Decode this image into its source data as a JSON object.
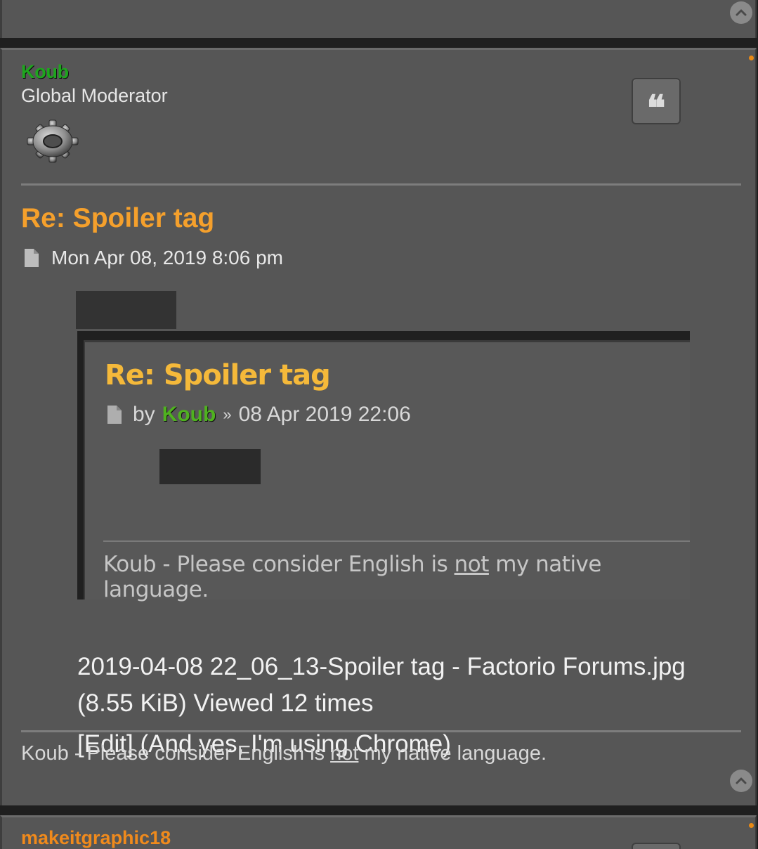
{
  "post": {
    "author": "Koub",
    "rank": "Global Moderator",
    "avatar_icon": "gear-icon",
    "title": "Re: Spoiler tag",
    "date": "Mon Apr 08, 2019 8:06 pm",
    "attachment": {
      "title": "Re: Spoiler tag",
      "by": "by",
      "author": "Koub",
      "separator": "»",
      "date": "08 Apr 2019 22:06",
      "signature_prefix": "Koub - Please consider English is ",
      "signature_emphasis": "not",
      "signature_suffix": " my native language."
    },
    "attachment_caption": "2019-04-08 22_06_13-Spoiler tag - Factorio Forums.jpg (8.55 KiB) Viewed 12 times",
    "edit_note": "[Edit] (And yes, I'm using Chrome)",
    "signature_prefix": "Koub - Please consider English is ",
    "signature_emphasis": "not",
    "signature_suffix": " my native language."
  },
  "next_post": {
    "author": "makeitgraphic18"
  },
  "colors": {
    "moderator_name": "#1ea51e",
    "post_title": "#f5a02c",
    "next_author": "#f08a1c",
    "online_dot": "#e98a15",
    "background": "#565656"
  },
  "icons": {
    "quote": "quote-icon",
    "back_to_top": "chevron-up-icon",
    "post_file": "file-icon"
  }
}
